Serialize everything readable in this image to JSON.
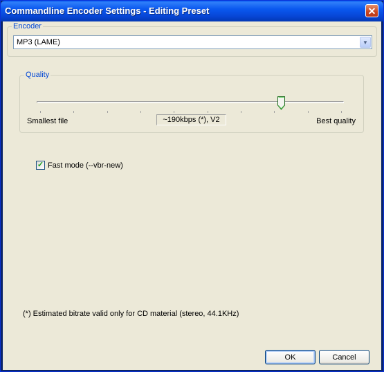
{
  "window": {
    "title": "Commandline Encoder Settings - Editing Preset",
    "close_icon": "close-icon"
  },
  "encoder": {
    "group_label": "Encoder",
    "selected": "MP3 (LAME)",
    "arrow_icon": "chevron-down-icon"
  },
  "quality": {
    "group_label": "Quality",
    "min_label": "Smallest file",
    "max_label": "Best quality",
    "value_label": "~190kbps (*), V2",
    "level": 0.8
  },
  "options": {
    "fast_mode_label": "Fast mode (--vbr-new)",
    "fast_mode_checked": true
  },
  "footnote": "(*) Estimated bitrate valid only for CD material (stereo, 44.1KHz)",
  "buttons": {
    "ok": "OK",
    "cancel": "Cancel"
  },
  "colors": {
    "titlebar": "#0a58ef",
    "dialog_bg": "#ece9d8",
    "group_label": "#0046d5"
  }
}
